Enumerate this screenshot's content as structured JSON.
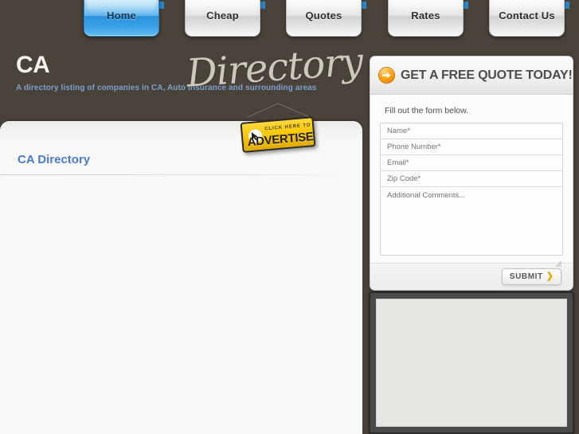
{
  "site": {
    "title": "CA",
    "script_logo": "Directory",
    "tagline": "A directory listing of companies in CA, Auto Insurance and surrounding areas"
  },
  "nav": {
    "tabs": [
      {
        "label": "Home",
        "active": true
      },
      {
        "label": "Cheap",
        "active": false
      },
      {
        "label": "Quotes",
        "active": false
      },
      {
        "label": "Rates",
        "active": false
      },
      {
        "label": "Contact Us",
        "active": false
      }
    ]
  },
  "advertise_badge": {
    "line1": "CLICK HERE TO",
    "line2": "ADVERTISE",
    "color": "#f5c400"
  },
  "main": {
    "heading": "CA Directory"
  },
  "quote_form": {
    "title": "GET A FREE QUOTE TODAY!",
    "intro": "Fill out the form below.",
    "fields": [
      {
        "name": "name",
        "placeholder": "Name*",
        "value": ""
      },
      {
        "name": "phone",
        "placeholder": "Phone Number*",
        "value": ""
      },
      {
        "name": "email",
        "placeholder": "Email*",
        "value": ""
      },
      {
        "name": "zip",
        "placeholder": "Zip Code*",
        "value": ""
      }
    ],
    "comments": {
      "placeholder": "Additional Comments...",
      "value": ""
    },
    "submit_label": "SUBMIT",
    "submit_chevron": "❯",
    "accent_color": "#f0a000"
  },
  "theme": {
    "page_background": "#4a4339",
    "heading_blue": "#4a7ad4",
    "tagline_blue": "#7d9fd4",
    "active_tab_blue": "#2b93de"
  }
}
